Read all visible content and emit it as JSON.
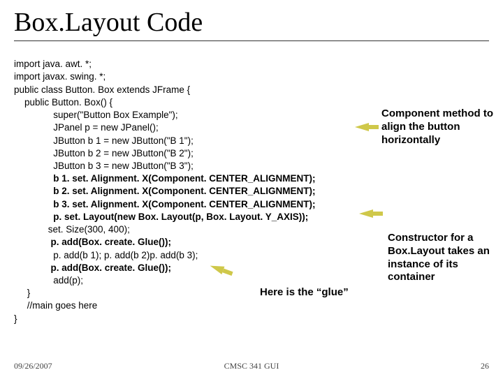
{
  "title": "Box.Layout Code",
  "code": {
    "l1": "import java. awt. *;",
    "l2": "import javax. swing. *;",
    "l3": "public class Button. Box extends JFrame {",
    "l4": "    public Button. Box() {",
    "l5": "               super(\"Button Box Example\");",
    "l6": "               JPanel p = new JPanel();",
    "l7": "               JButton b 1 = new JButton(\"B 1\");",
    "l8": "               JButton b 2 = new JButton(\"B 2\");",
    "l9": "               JButton b 3 = new JButton(\"B 3\");",
    "l10": "               b 1. set. Alignment. X(Component. CENTER_ALIGNMENT);",
    "l11": "               b 2. set. Alignment. X(Component. CENTER_ALIGNMENT);",
    "l12": "               b 3. set. Alignment. X(Component. CENTER_ALIGNMENT);",
    "l13": "               p. set. Layout(new Box. Layout(p, Box. Layout. Y_AXIS));",
    "l14": "             set. Size(300, 400);",
    "l15": "              p. add(Box. create. Glue());",
    "l16": "               p. add(b 1); p. add(b 2)p. add(b 3);",
    "l17": "              p. add(Box. create. Glue());",
    "l18": "               add(p);",
    "l19": "     }",
    "l20": "     //main goes here",
    "l21": "}"
  },
  "annotations": {
    "a1": "Component method to align the button horizontally",
    "a2": "Constructor for a Box.Layout takes an instance of its container",
    "a3": "Here is the “glue”"
  },
  "footer": {
    "date": "09/26/2007",
    "center": "CMSC 341 GUI",
    "page": "26"
  }
}
